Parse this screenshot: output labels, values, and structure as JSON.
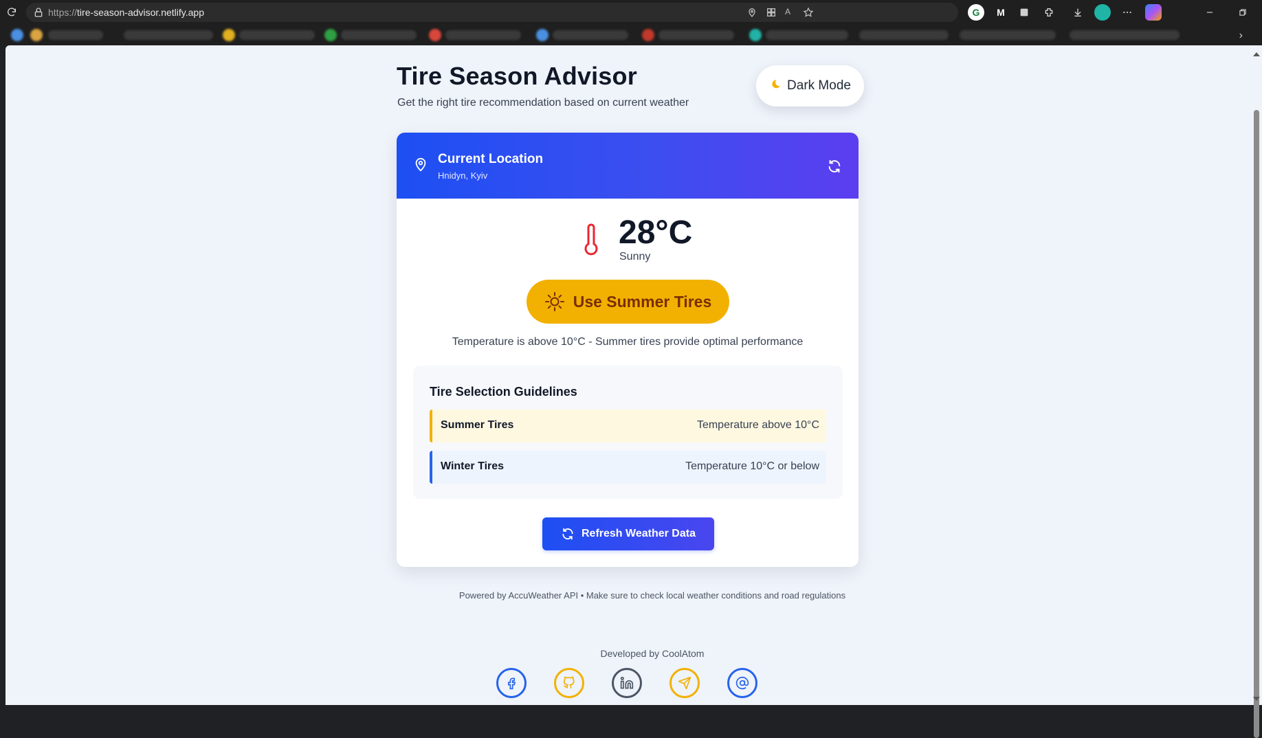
{
  "browser": {
    "url_scheme": "https://",
    "url_host": "tire-season-advisor.netlify.app"
  },
  "header": {
    "title": "Tire Season Advisor",
    "subtitle": "Get the right tire recommendation based on current weather",
    "dark_mode_label": "Dark Mode"
  },
  "location": {
    "title": "Current Location",
    "place": "Hnidyn, Kyiv"
  },
  "weather": {
    "temperature": "28°C",
    "condition": "Sunny"
  },
  "recommendation": {
    "label": "Use Summer Tires",
    "note": "Temperature is above 10°C - Summer tires provide optimal performance"
  },
  "guidelines": {
    "title": "Tire Selection Guidelines",
    "rows": [
      {
        "name": "Summer Tires",
        "condition": "Temperature above 10°C"
      },
      {
        "name": "Winter Tires",
        "condition": "Temperature 10°C or below"
      }
    ]
  },
  "refresh_button_label": "Refresh Weather Data",
  "footer": {
    "powered_by": "Powered by AccuWeather API • Make sure to check local weather conditions and road regulations",
    "developed_by": "Developed by CoolAtom"
  },
  "social_icons": [
    "facebook-icon",
    "github-icon",
    "linkedin-icon",
    "telegram-icon",
    "email-icon"
  ],
  "colors": {
    "header_gradient_start": "#1d4ff3",
    "header_gradient_end": "#5b3ef0",
    "summer_accent": "#f2b100",
    "winter_accent": "#2563eb",
    "thermometer": "#ea2630",
    "page_background": "#eff3fa"
  }
}
